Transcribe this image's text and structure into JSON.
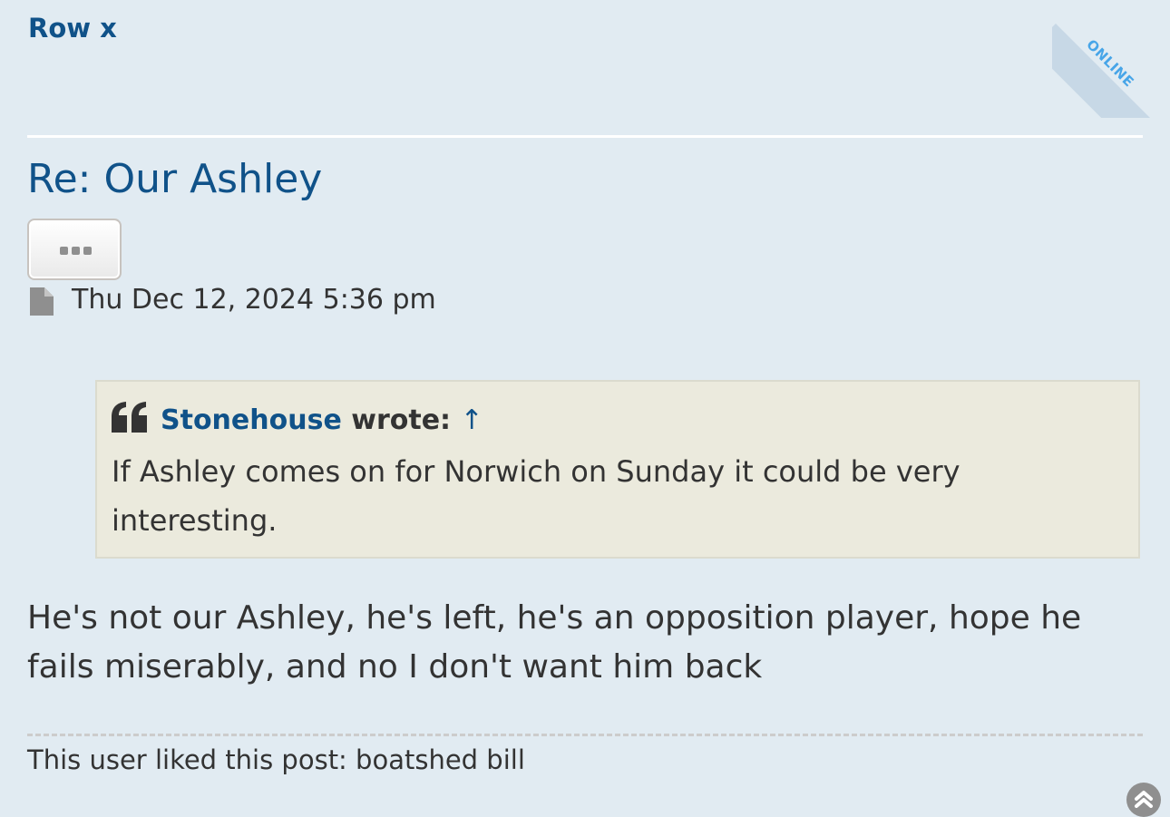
{
  "post": {
    "author": "Row x",
    "online_status": "ONLINE",
    "title": "Re: Our Ashley",
    "more_button_icon": "ellipsis-icon",
    "post_icon": "file-icon",
    "date": "Thu Dec 12, 2024 5:36 pm",
    "quote": {
      "icon": "quote-icon",
      "author": "Stonehouse",
      "wrote": "wrote:",
      "arrow": "↑",
      "text": "If Ashley comes on for Norwich on Sunday it could be very interesting."
    },
    "body": "He's not our Ashley, he's left, he's an opposition player, hope he fails miserably, and no I don't want him back",
    "likes_text": "This user liked this post: boatshed bill",
    "back_to_top_icon": "chevron-up-icon"
  },
  "colors": {
    "background": "#e1ebf2",
    "link": "#105289",
    "quote_background": "#ebeadd",
    "online_badge": "#47a5e8"
  }
}
